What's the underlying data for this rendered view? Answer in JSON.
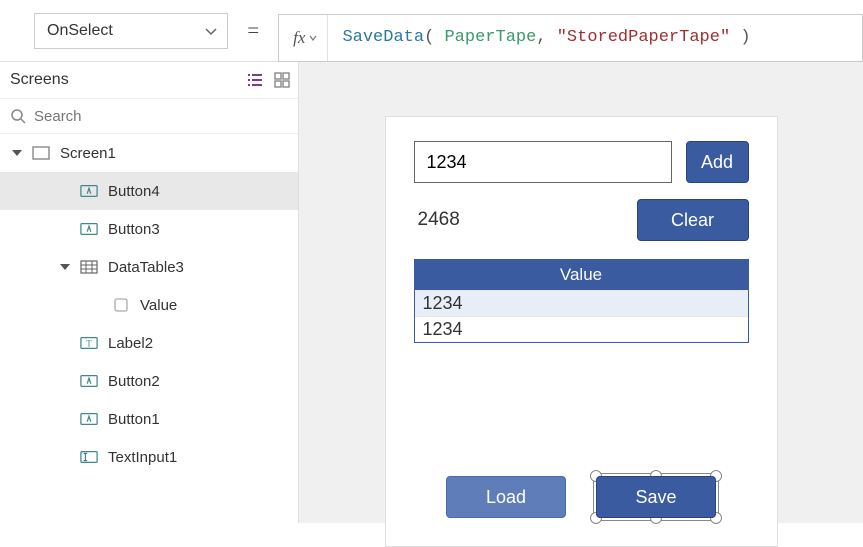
{
  "formulaBar": {
    "property": "OnSelect",
    "fxLabel": "fx",
    "formula": {
      "fn": "SaveData",
      "open": "( ",
      "arg1": "PaperTape",
      "comma": ", ",
      "arg2": "\"StoredPaperTape\"",
      "close": " )"
    }
  },
  "sidebar": {
    "title": "Screens",
    "searchPlaceholder": "Search"
  },
  "tree": {
    "screen": {
      "name": "Screen1",
      "children": [
        {
          "name": "Button4",
          "type": "button",
          "selected": true
        },
        {
          "name": "Button3",
          "type": "button"
        },
        {
          "name": "DataTable3",
          "type": "datatable",
          "expanded": true,
          "children": [
            {
              "name": "Value",
              "type": "column"
            }
          ]
        },
        {
          "name": "Label2",
          "type": "label"
        },
        {
          "name": "Button2",
          "type": "button"
        },
        {
          "name": "Button1",
          "type": "button"
        },
        {
          "name": "TextInput1",
          "type": "textinput"
        }
      ]
    }
  },
  "app": {
    "inputValue": "1234",
    "addLabel": "Add",
    "labelValue": "2468",
    "clearLabel": "Clear",
    "table": {
      "header": "Value",
      "rows": [
        "1234",
        "1234"
      ]
    },
    "loadLabel": "Load",
    "saveLabel": "Save"
  }
}
